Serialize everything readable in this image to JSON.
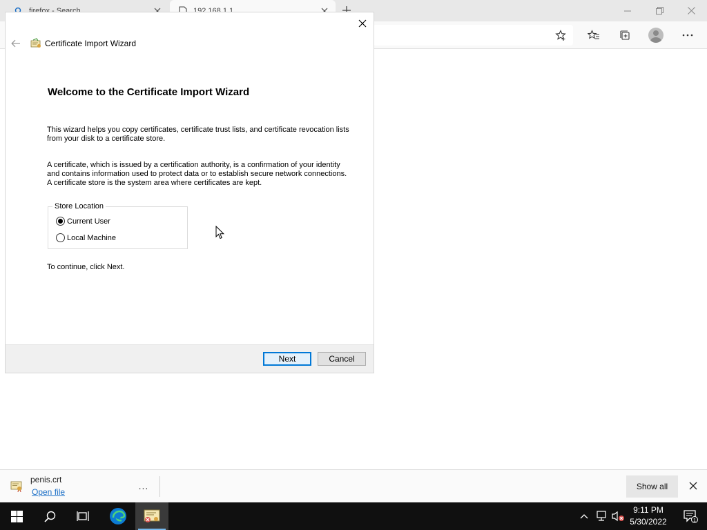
{
  "browser": {
    "tabs": [
      {
        "title": "firefox - Search",
        "icon": "search-icon"
      },
      {
        "title": "192.168.1.1",
        "icon": "page-icon"
      }
    ],
    "window_controls": [
      "minimize-icon",
      "restore-icon",
      "close-icon"
    ],
    "toolbar_icons": [
      "favorite-star-icon",
      "favorites-icon",
      "collections-icon",
      "profile-icon",
      "more-icon"
    ]
  },
  "dialog": {
    "title": "Certificate Import Wizard",
    "heading": "Welcome to the Certificate Import Wizard",
    "paragraph_1": "This wizard helps you copy certificates, certificate trust lists, and certificate revocation lists from your disk to a certificate store.",
    "paragraph_2": "A certificate, which is issued by a certification authority, is a confirmation of your identity and contains information used to protect data or to establish secure network connections. A certificate store is the system area where certificates are kept.",
    "store_location": {
      "legend": "Store Location",
      "options": [
        {
          "label": "Current User",
          "selected": true
        },
        {
          "label": "Local Machine",
          "selected": false
        }
      ]
    },
    "continue_text": "To continue, click Next.",
    "buttons": {
      "next": "Next",
      "cancel": "Cancel"
    }
  },
  "download_bar": {
    "file_name": "penis.crt",
    "open_link": "Open file",
    "more": "...",
    "show_all": "Show all"
  },
  "taskbar": {
    "time": "9:11 PM",
    "date": "5/30/2022",
    "notification_count": "1",
    "accent": "#0078d7"
  }
}
